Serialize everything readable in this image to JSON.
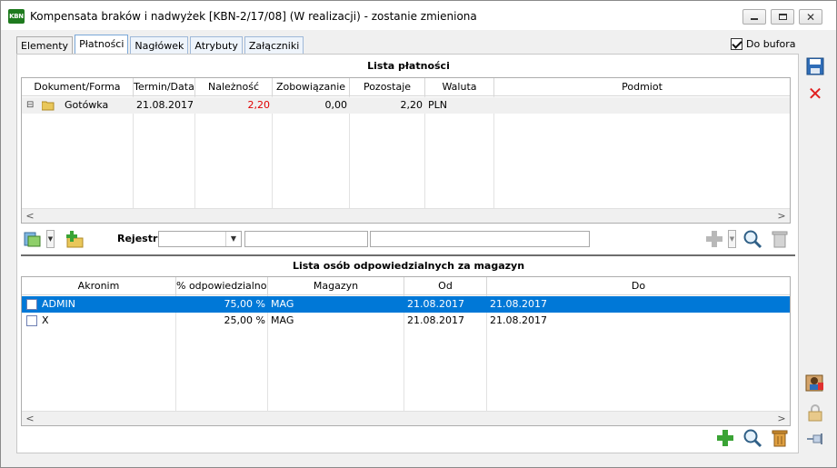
{
  "window": {
    "app_icon": "KBN",
    "title": "Kompensata braków i nadwyżek [KBN-2/17/08] (W realizacji) - zostanie zmieniona",
    "controls": [
      "minimize-icon",
      "maximize-icon",
      "close-icon"
    ]
  },
  "tabs": [
    {
      "label": "Elementy"
    },
    {
      "label": "Płatności"
    },
    {
      "label": "Nagłówek"
    },
    {
      "label": "Atrybuty"
    },
    {
      "label": "Załączniki"
    }
  ],
  "active_tab": "Płatności",
  "bufor": {
    "label": "Do bufora",
    "checked": true
  },
  "payments": {
    "title": "Lista płatności",
    "columns": [
      "Dokument/Forma",
      "Termin/Data",
      "Należność",
      "Zobowiązanie",
      "Pozostaje",
      "Waluta",
      "Podmiot"
    ],
    "rows": [
      {
        "expander": "⊟",
        "dokument": "Gotówka",
        "termin": "21.08.2017",
        "naleznosc": "2,20",
        "zobowiazanie": "0,00",
        "pozostaje": "2,20",
        "waluta": "PLN",
        "podmiot": ""
      }
    ],
    "rejestr_label": "Rejestr:",
    "rejestr_value": ""
  },
  "responsible": {
    "title": "Lista osób odpowiedzialnych za magazyn",
    "columns": [
      "Akronim",
      "% odpowiedzialności",
      "Magazyn",
      "Od",
      "Do"
    ],
    "rows": [
      {
        "akronim": "ADMIN",
        "procent": "75,00 %",
        "magazyn": "MAG",
        "od": "21.08.2017",
        "do": "21.08.2017",
        "selected": true
      },
      {
        "akronim": "X",
        "procent": "25,00 %",
        "magazyn": "MAG",
        "od": "21.08.2017",
        "do": "21.08.2017",
        "selected": false
      }
    ]
  },
  "colors": {
    "selection": "#0078d7",
    "negative": "#e00000",
    "accent_green": "#3aa335"
  }
}
